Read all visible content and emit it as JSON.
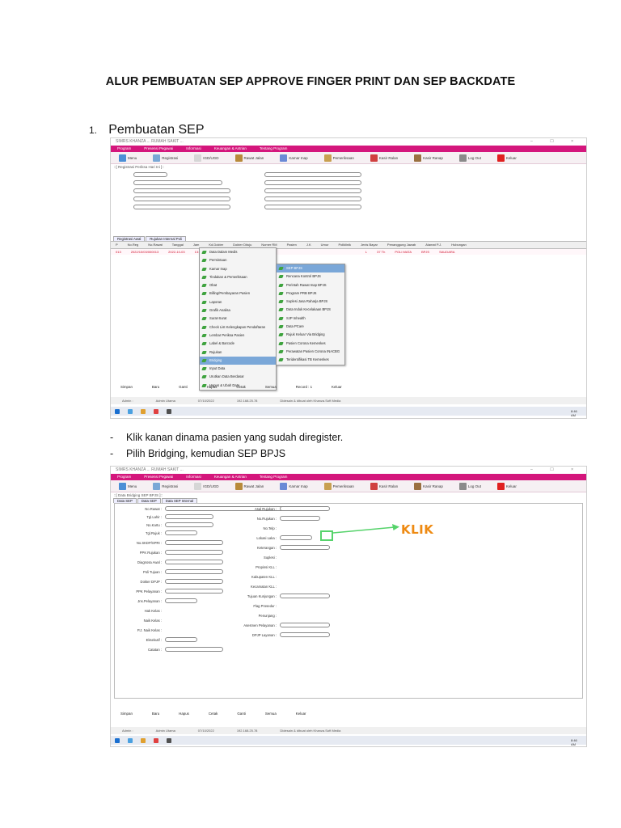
{
  "document": {
    "title": "ALUR PEMBUATAN SEP APPROVE FINGER PRINT DAN SEP BACKDATE",
    "section_number": "1.",
    "section_title": "Pembuatan SEP",
    "bullets": [
      "Klik kanan dinama pasien yang sudah diregister.",
      "Pilih Bridging, kemudian SEP BPJS"
    ],
    "annotation": "KLIK"
  },
  "screen1": {
    "window_title": "SIMRS KHANZA ... RUMAH SAKIT ...",
    "menu": [
      "Program",
      "Presensi Pegawai",
      "Informasi",
      "Keuangan & Antrian",
      "Tentang Program"
    ],
    "toolbar": [
      "Menu",
      "Registrasi",
      "IGD/UGD",
      "Rawat Jalan",
      "Kamar Inap",
      "Pemeriksaan",
      "Kasir Ralan",
      "Kasir Ranap",
      "Log Out",
      "Keluar"
    ],
    "breadcrumb": "::[ Registrasi Periksa Hari Ini ]::",
    "tabs": [
      "Registrasi Awal",
      "Rujukan Internal Poli"
    ],
    "columns": [
      "P",
      "No.Reg",
      "No.Rawat",
      "Tanggal",
      "Jam",
      "Kd.Dokter",
      "Dokter Dituju",
      "Nomer RM",
      "Pasien",
      "J.K",
      "Umur",
      "Poliklinik",
      "Jenis Bayar",
      "Penanggung Jawab",
      "Alamat P.J.",
      "Hubungan"
    ],
    "row": [
      "",
      "013",
      "2022/10/03/000013",
      "2022-10-03",
      "13:35:11",
      "",
      "",
      "",
      "",
      "L",
      "37 Th",
      "POLI MATA",
      "BPJS",
      "",
      "",
      "SAUDARA"
    ],
    "context_menu": [
      "Data Dalam Medis",
      "Permintaan",
      "Kamar Inap",
      "Tindakan & Pemeriksaan",
      "Obat",
      "Billing/Pembayaran Pasien",
      "Laporan",
      "Grafik Analisa",
      "Surat-Surat",
      "Check List Kelengkapan Pendaftaran",
      "Lembar Periksa Pasien",
      "Label & Barcode",
      "Rujukan",
      "Bridging",
      "Input Data",
      "Urutkan Data Berdasar",
      "Hapus & Ubah Data"
    ],
    "submenu": [
      "SEP BPJS",
      "Rencana Kontrol BPJS",
      "Perintah Rawat Inap BPJS",
      "Program PRB BPJS",
      "Suplesi Jasa Raharja BPJS",
      "Data Induk Kecelakaan BPJS",
      "SJP Inhealth",
      "Data PCare",
      "Rujuk Keluar Via Bridging",
      "Pasien Corona Kemenkes",
      "Perawatan Pasien Corona INACBG",
      "Teridentifikasi TB Kemenkes"
    ],
    "actions": [
      "Simpan",
      "Baru",
      "Ganti",
      "Hapus",
      "Cetak",
      "Semua",
      "Record : 1",
      "Keluar"
    ],
    "status": [
      "Admin :",
      "Admin Utama",
      "07/10/2022",
      "192.168.25.78",
      "Didesain & dibuat oleh Khanza.Soft Media"
    ],
    "time": "8:46 AM"
  },
  "screen2": {
    "breadcrumb": "::[ Data Bridging SEP BPJS ]::",
    "tabs": [
      "Data SEP",
      "Data SEP",
      "Data SEP Internal"
    ],
    "fields_left": [
      "No.Rawat :",
      "Tgl.Lahir :",
      "No.Kartu :",
      "Tgl.Rujuk :",
      "No.SKDP/SPRI :",
      "PPK Rujukan :",
      "Diagnosa Awal :",
      "Poli Tujuan :",
      "Dokter DPJP :",
      "PPK Pelayanan :",
      "Jns.Pelayanan :",
      "Hak Kelas :",
      "Naik Kelas :",
      "P.J. Naik Kelas :",
      "Eksekutif :",
      "Catatan :"
    ],
    "fields_right": [
      "Asal Rujukan :",
      "No.Rujukan :",
      "No.Telp :",
      "Lokasi Laka :",
      "Keterangan :",
      "Suplesi :",
      "Propinsi KLL :",
      "Kabupaten KLL :",
      "Kecamatan KLL :",
      "Tujuan Kunjungan :",
      "Flag Prosedur :",
      "Penunjang :",
      "Asesmen Pelayanan :",
      "DPJP Layanan :"
    ],
    "actions": [
      "Simpan",
      "Baru",
      "Hapus",
      "Cetak",
      "Ganti",
      "Semua",
      "Keluar"
    ]
  },
  "colors": {
    "menubar": "#d4167c",
    "annotation": "#ee8a12",
    "highlight_box": "#56d36b",
    "menu_selection": "#7aa7d8"
  }
}
